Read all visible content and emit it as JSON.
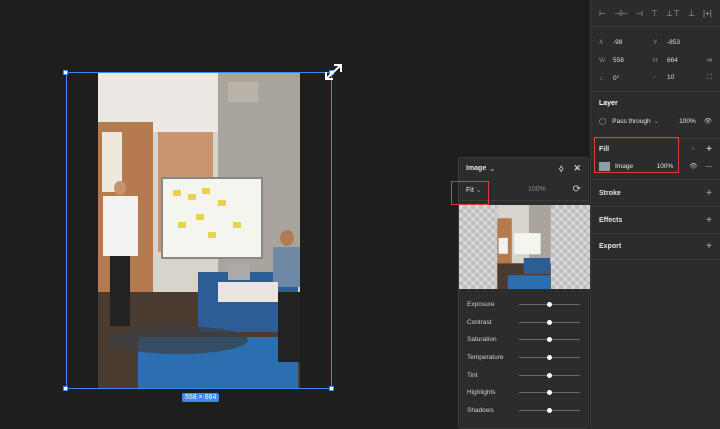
{
  "canvas": {
    "size_badge": "558 × 664"
  },
  "image_popup": {
    "title": "Image",
    "chevron": "⌄",
    "scale_mode": "Fit",
    "opacity": "100%",
    "adjustments": [
      {
        "label": "Exposure",
        "value": 0.5
      },
      {
        "label": "Contrast",
        "value": 0.5
      },
      {
        "label": "Saturation",
        "value": 0.5
      },
      {
        "label": "Temperature",
        "value": 0.5
      },
      {
        "label": "Tint",
        "value": 0.5
      },
      {
        "label": "Highlights",
        "value": 0.5
      },
      {
        "label": "Shadows",
        "value": 0.5
      }
    ]
  },
  "panel": {
    "x_label": "X",
    "x_value": "-98",
    "y_label": "Y",
    "y_value": "-853",
    "w_label": "W",
    "w_value": "558",
    "h_label": "H",
    "h_value": "664",
    "rotation": "0°",
    "radius": "10",
    "layer": {
      "title": "Layer",
      "blend": "Pass through",
      "opacity": "100%"
    },
    "fill": {
      "title": "Fill",
      "type": "Image",
      "opacity": "100%"
    },
    "stroke": "Stroke",
    "effects": "Effects",
    "export": "Export"
  },
  "colors": {
    "accent": "#3d8bf2",
    "highlight": "#e23b3b",
    "panel": "#2c2c2c",
    "canvas": "#1e1e1e"
  }
}
